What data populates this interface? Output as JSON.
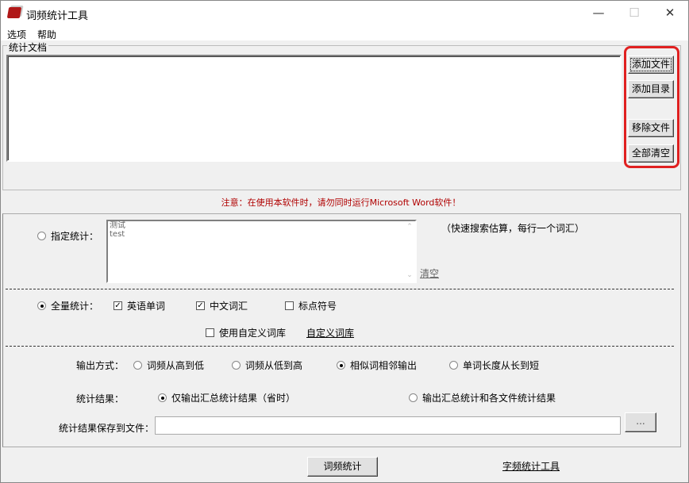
{
  "window": {
    "title": "词频统计工具",
    "minimize": "—",
    "maximize": "☐",
    "close": "✕"
  },
  "menu": [
    "选项",
    "帮助"
  ],
  "documents": {
    "legend": "统计文档",
    "buttons": [
      "添加文件",
      "添加目录",
      "移除文件",
      "全部清空"
    ]
  },
  "warning": "注意：在使用本软件时，请勿同时运行Microsoft Word软件！",
  "specified": {
    "label": "指定统计：",
    "text_lines": [
      "测试",
      "test"
    ],
    "hint": "（快速搜索估算，每行一个词汇）",
    "clear": "清空",
    "checked": false
  },
  "full": {
    "label": "全量统计：",
    "checked": true,
    "options": [
      {
        "label": "英语单词",
        "checked": true
      },
      {
        "label": "中文词汇",
        "checked": true
      },
      {
        "label": "标点符号",
        "checked": false
      }
    ],
    "custom_dict": {
      "label": "使用自定义词库",
      "checked": false
    },
    "custom_dict_link": "自定义词库"
  },
  "output": {
    "label": "输出方式：",
    "options": [
      {
        "label": "词频从高到低",
        "checked": false
      },
      {
        "label": "词频从低到高",
        "checked": false
      },
      {
        "label": "相似词相邻输出",
        "checked": true
      },
      {
        "label": "单词长度从长到短",
        "checked": false
      }
    ]
  },
  "result": {
    "label": "统计结果：",
    "options": [
      {
        "label": "仅输出汇总统计结果（省时）",
        "checked": true
      },
      {
        "label": "输出汇总统计和各文件统计结果",
        "checked": false
      }
    ]
  },
  "save": {
    "label": "统计结果保存到文件：",
    "value": "",
    "browse": "..."
  },
  "footer": {
    "run": "词频统计",
    "link": "字频统计工具"
  }
}
